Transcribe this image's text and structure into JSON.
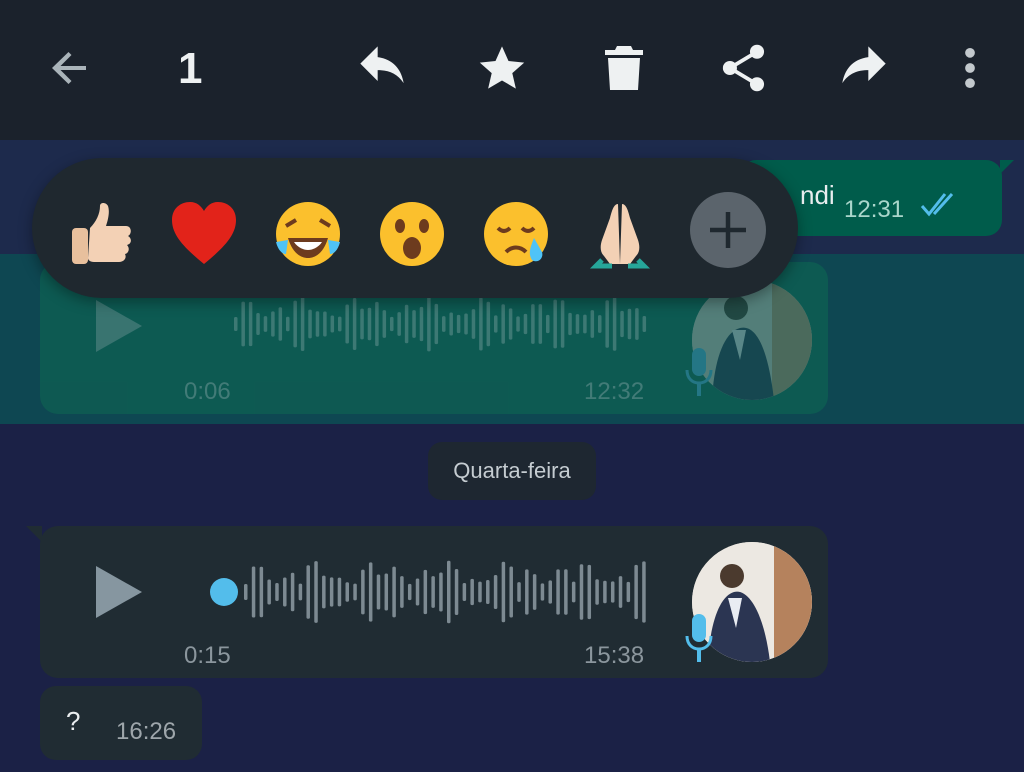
{
  "toolbar": {
    "selected_count": "1",
    "icons": [
      "back-arrow-icon",
      "reply-icon",
      "star-icon",
      "delete-icon",
      "share-icon",
      "forward-icon",
      "more-options-icon"
    ]
  },
  "reactions": {
    "emojis": [
      "thumbs-up",
      "red-heart",
      "tears-of-joy",
      "astonished",
      "crying",
      "folded-hands"
    ],
    "more": "add-reaction-icon"
  },
  "messages": {
    "outgoing": {
      "text": "ndi",
      "time": "12:31",
      "status": "read-double-tick"
    },
    "voice_selected": {
      "duration": "0:06",
      "time": "12:32",
      "progress": 1.0
    },
    "date_separator": "Quarta-feira",
    "voice_incoming": {
      "duration": "0:15",
      "time": "15:38",
      "progress": 0.0
    },
    "text_incoming": {
      "text": "?",
      "time": "16:26"
    }
  },
  "colors": {
    "header_bg": "#1b222c",
    "chat_bg": "#1b2146",
    "outgoing_bubble": "#005c4b",
    "incoming_bubble": "#202c33",
    "accent_blue": "#53bdeb"
  }
}
